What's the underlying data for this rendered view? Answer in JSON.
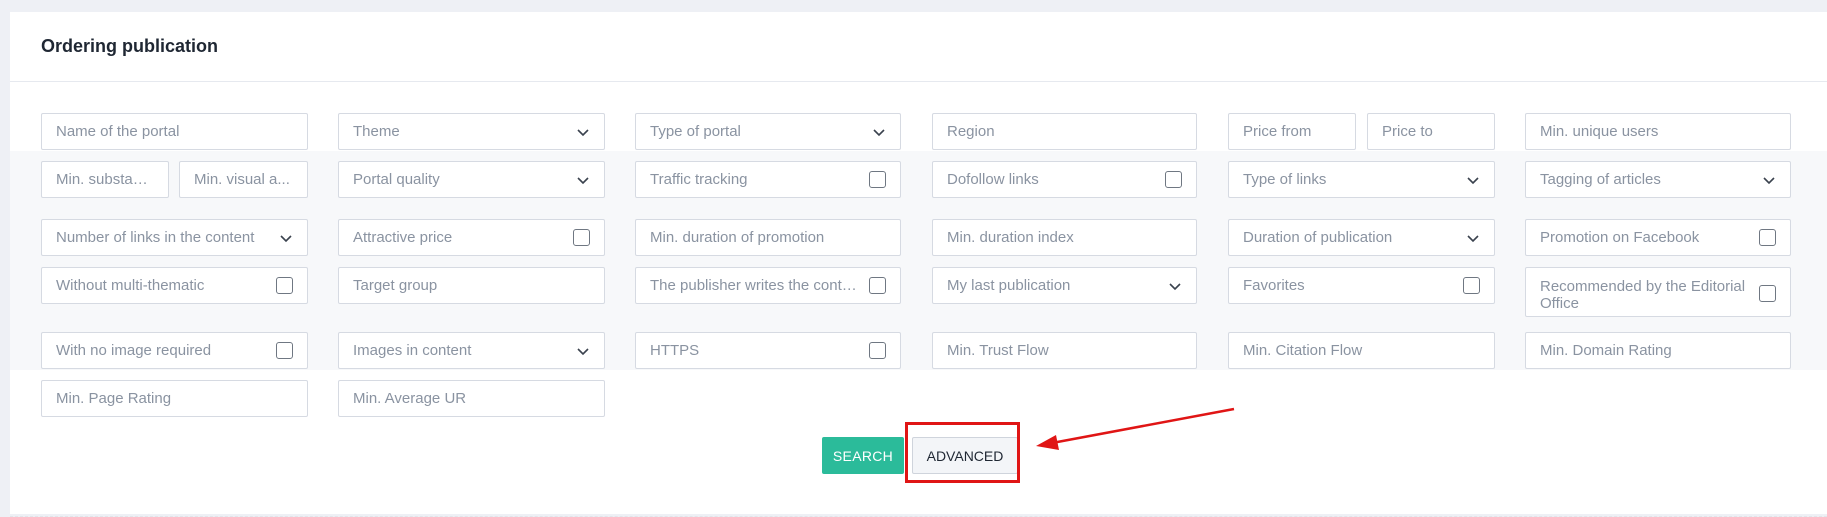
{
  "header": {
    "title": "Ordering publication"
  },
  "filters": {
    "row1": {
      "portal_name": "Name of the portal",
      "theme": "Theme",
      "type_of_portal": "Type of portal",
      "region": "Region",
      "price_from": "Price from",
      "price_to": "Price to",
      "min_unique_users": "Min. unique users"
    },
    "row2": {
      "min_substantive": "Min. substant...",
      "min_visual": "Min. visual a...",
      "portal_quality": "Portal quality",
      "traffic_tracking": "Traffic tracking",
      "dofollow_links": "Dofollow links",
      "type_of_links": "Type of links",
      "tagging_of_articles": "Tagging of articles"
    },
    "advanced": {
      "num_links_content": "Number of links in the content",
      "attractive_price": "Attractive price",
      "min_duration_promotion": "Min. duration of promotion",
      "min_duration_index": "Min. duration index",
      "duration_publication": "Duration of publication",
      "promotion_facebook": "Promotion on Facebook",
      "without_multithematic": "Without multi-thematic",
      "target_group": "Target group",
      "publisher_writes": "The publisher writes the content",
      "my_last_publication": "My last publication",
      "favorites": "Favorites",
      "recommended_editorial": "Recommended by the Editorial Office",
      "no_image_required": "With no image required",
      "images_in_content": "Images in content",
      "https": "HTTPS",
      "min_trust_flow": "Min. Trust Flow",
      "min_citation_flow": "Min. Citation Flow",
      "min_domain_rating": "Min. Domain Rating",
      "min_page_rating": "Min. Page Rating",
      "min_average_ur": "Min. Average UR"
    }
  },
  "actions": {
    "search_label": "SEARCH",
    "advanced_label": "ADVANCED"
  },
  "colors": {
    "accent": "#2bbb9a",
    "annotation": "#e01515"
  }
}
